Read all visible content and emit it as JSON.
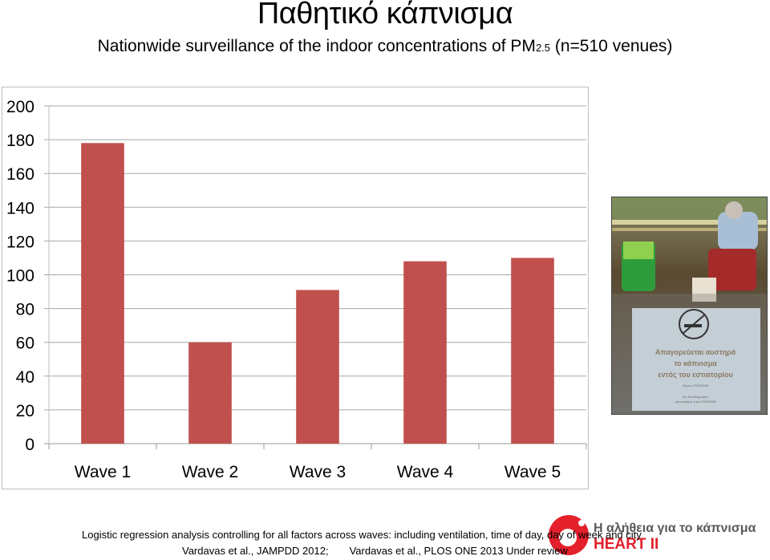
{
  "slide": {
    "title": "Παθητικό κάπνισμα",
    "subtitle_main": "Nationwide surveillance of the indoor concentrations of PM",
    "subtitle_subscript": "2.5",
    "subtitle_tail": " (n=510 venues)"
  },
  "chart_data": {
    "type": "bar",
    "title": "",
    "xlabel": "",
    "ylabel": "",
    "categories": [
      "Wave 1",
      "Wave 2",
      "Wave 3",
      "Wave 4",
      "Wave 5"
    ],
    "values": [
      178,
      60,
      91,
      108,
      110
    ],
    "ylim": [
      0,
      200
    ],
    "yticks": [
      0,
      20,
      40,
      60,
      80,
      100,
      120,
      140,
      160,
      180,
      200
    ],
    "grid": true,
    "legend": "none",
    "bar_color": "#c0504d",
    "grid_color": "#a6a6a6"
  },
  "photo": {
    "description": "No-smoking sign hanging in restaurant window",
    "sign_line1": "Απαγορεύεται αυστηρά",
    "sign_line2": "το κάπνισμα",
    "sign_line3": "εντός του εστιατορίου",
    "sign_small1": "Νόμος 3730/2008",
    "sign_small2": "No Smoking Area",
    "sign_small3": "according to Law 3730/2008"
  },
  "footer": {
    "line1": "Logistic regression analysis controlling for all factors across waves: including ventilation, time of day, day of week and city",
    "ref1": "Vardavas et al., JAMPDD 2012;",
    "ref2": "Vardavas et al., PLOS ONE 2013 Under review"
  },
  "logo": {
    "tagline": "Η αλήθεια για το κάπνισμα",
    "name": "HEART II",
    "brand_color": "#e3202c"
  }
}
